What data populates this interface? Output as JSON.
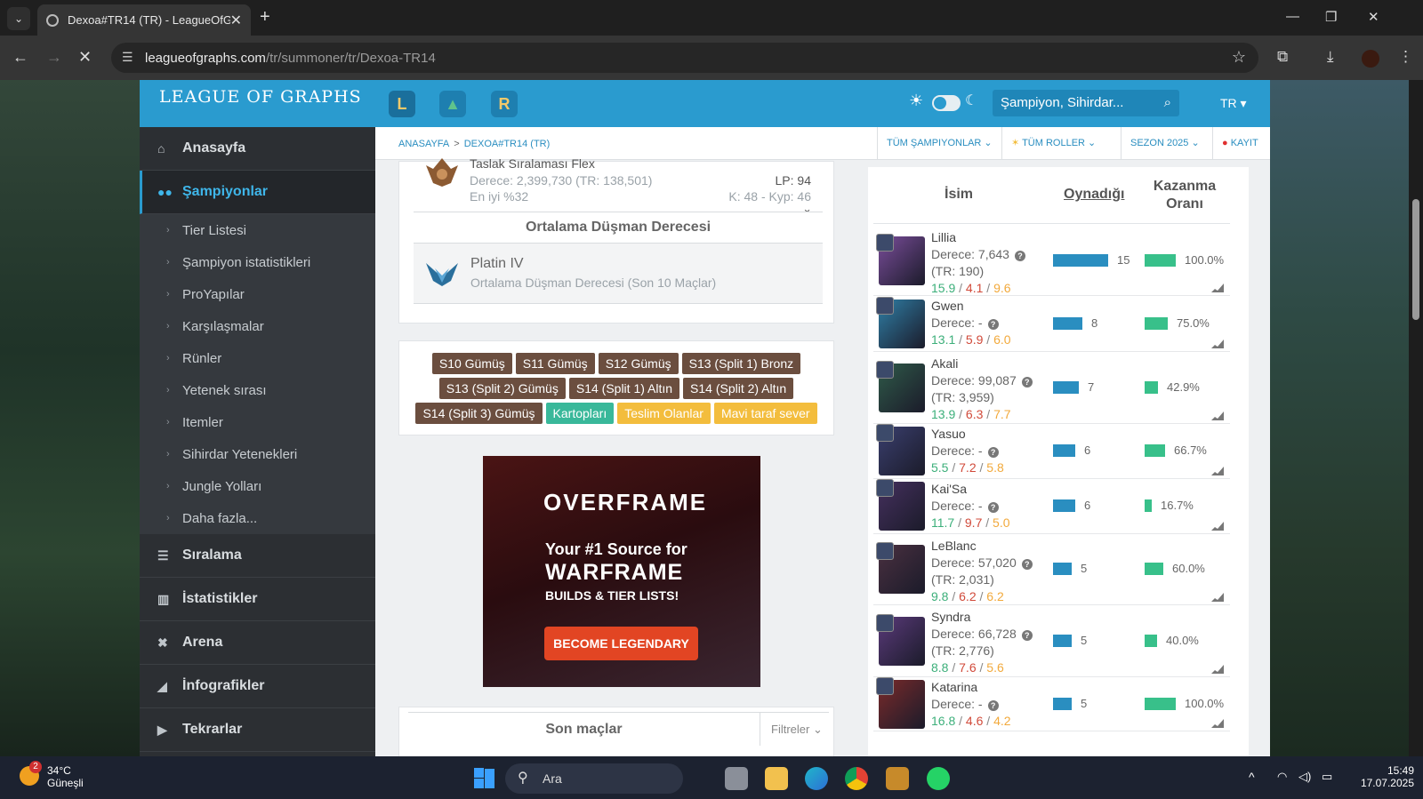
{
  "browser": {
    "tab_title": "Dexoa#TR14 (TR) - LeagueOfGr",
    "url_host": "leagueofgraphs.com",
    "url_path": "/tr/summoner/tr/Dexoa-TR14"
  },
  "site": {
    "logo": "LEAGUE OF GRAPHS",
    "search_placeholder": "Şampiyon, Sihirdar...",
    "lang": "TR"
  },
  "sidebar": {
    "home": "Anasayfa",
    "champions": "Şampiyonlar",
    "sub_items": [
      "Tier Listesi",
      "Şampiyon istatistikleri",
      "ProYapılar",
      "Karşılaşmalar",
      "Rünler",
      "Yetenek sırası",
      "Itemler",
      "Sihirdar Yetenekleri",
      "Jungle Yolları",
      "Daha fazla..."
    ],
    "ranking": "Sıralama",
    "stats": "İstatistikler",
    "arena": "Arena",
    "infographics": "İnfografikler",
    "replays": "Tekrarlar"
  },
  "breadcrumb": {
    "home": "ANASAYFA",
    "sep": ">",
    "current": "DEXOA#TR14 (TR)"
  },
  "filters": {
    "champions": "TÜM ŞAMPIYONLAR",
    "roles": "TÜM ROLLER",
    "season": "SEZON 2025",
    "record": "KAYIT"
  },
  "flex": {
    "title": "Taslak Sıralaması Flex",
    "rank": "Derece: 2,399,730 (TR: 138,501)",
    "best": "En iyi %32",
    "lp": "LP: 94",
    "kw": "K: 48 - Kyp: 46"
  },
  "avg_enemy": {
    "header": "Ortalama Düşman Derecesi",
    "tier": "Platin IV",
    "desc": "Ortalama Düşman Derecesi (Son 10 Maçlar)"
  },
  "badges": [
    {
      "label": "S10 Gümüş",
      "style": "brown"
    },
    {
      "label": "S11 Gümüş",
      "style": "brown"
    },
    {
      "label": "S12 Gümüş",
      "style": "brown"
    },
    {
      "label": "S13 (Split 1) Bronz",
      "style": "brown"
    },
    {
      "label": "S13 (Split 2) Gümüş",
      "style": "brown"
    },
    {
      "label": "S14 (Split 1) Altın",
      "style": "brown"
    },
    {
      "label": "S14 (Split 2) Altın",
      "style": "brown"
    },
    {
      "label": "S14 (Split 3) Gümüş",
      "style": "brown"
    },
    {
      "label": "Kartopları",
      "style": "green"
    },
    {
      "label": "Teslim Olanlar",
      "style": "yellow"
    },
    {
      "label": "Mavi taraf sever",
      "style": "yellow"
    }
  ],
  "ad": {
    "brand": "OVERFRAME",
    "line1": "Your #1 Source for",
    "line2": "WARFRAME",
    "line3": "BUILDS & TIER LISTS!",
    "cta": "BECOME LEGENDARY"
  },
  "last_matches": {
    "title": "Son maçlar",
    "filters": "Filtreler"
  },
  "champ_table": {
    "col_name": "İsim",
    "col_played": "Oynadığı",
    "col_winrate": "Kazanma Oranı",
    "rows": [
      {
        "name": "Lillia",
        "rank": "Derece: 7,643",
        "rank2": "(TR: 190)",
        "k": "15.9",
        "d": "4.1",
        "a": "9.6",
        "played": 15,
        "played_label": "15",
        "win": 1.0,
        "win_label": "100.0%",
        "color": "#7a4d9a"
      },
      {
        "name": "Gwen",
        "rank": "Derece: -",
        "rank2": "",
        "k": "13.1",
        "d": "5.9",
        "a": "6.0",
        "played": 8,
        "played_label": "8",
        "win": 0.75,
        "win_label": "75.0%",
        "color": "#2f7fa6"
      },
      {
        "name": "Akali",
        "rank": "Derece: 99,087",
        "rank2": "(TR: 3,959)",
        "k": "13.9",
        "d": "6.3",
        "a": "7.7",
        "played": 7,
        "played_label": "7",
        "win": 0.429,
        "win_label": "42.9%",
        "color": "#2f5a49"
      },
      {
        "name": "Yasuo",
        "rank": "Derece: -",
        "rank2": "",
        "k": "5.5",
        "d": "7.2",
        "a": "5.8",
        "played": 6,
        "played_label": "6",
        "win": 0.667,
        "win_label": "66.7%",
        "color": "#3a3f6e"
      },
      {
        "name": "Kai'Sa",
        "rank": "Derece: -",
        "rank2": "",
        "k": "11.7",
        "d": "9.7",
        "a": "5.0",
        "played": 6,
        "played_label": "6",
        "win": 0.167,
        "win_label": "16.7%",
        "color": "#45305e"
      },
      {
        "name": "LeBlanc",
        "rank": "Derece: 57,020",
        "rank2": "(TR: 2,031)",
        "k": "9.8",
        "d": "6.2",
        "a": "6.2",
        "played": 5,
        "played_label": "5",
        "win": 0.6,
        "win_label": "60.0%",
        "color": "#4a3040"
      },
      {
        "name": "Syndra",
        "rank": "Derece: 66,728",
        "rank2": "(TR: 2,776)",
        "k": "8.8",
        "d": "7.6",
        "a": "5.6",
        "played": 5,
        "played_label": "5",
        "win": 0.4,
        "win_label": "40.0%",
        "color": "#5a3a7a"
      },
      {
        "name": "Katarina",
        "rank": "Derece: -",
        "rank2": "",
        "k": "16.8",
        "d": "4.6",
        "a": "4.2",
        "played": 5,
        "played_label": "5",
        "win": 1.0,
        "win_label": "100.0%",
        "color": "#7a2a2a"
      }
    ]
  },
  "taskbar": {
    "temp": "34°C",
    "weather": "Güneşli",
    "search": "Ara",
    "time": "15:49",
    "date": "17.07.2025",
    "notif": "2"
  }
}
